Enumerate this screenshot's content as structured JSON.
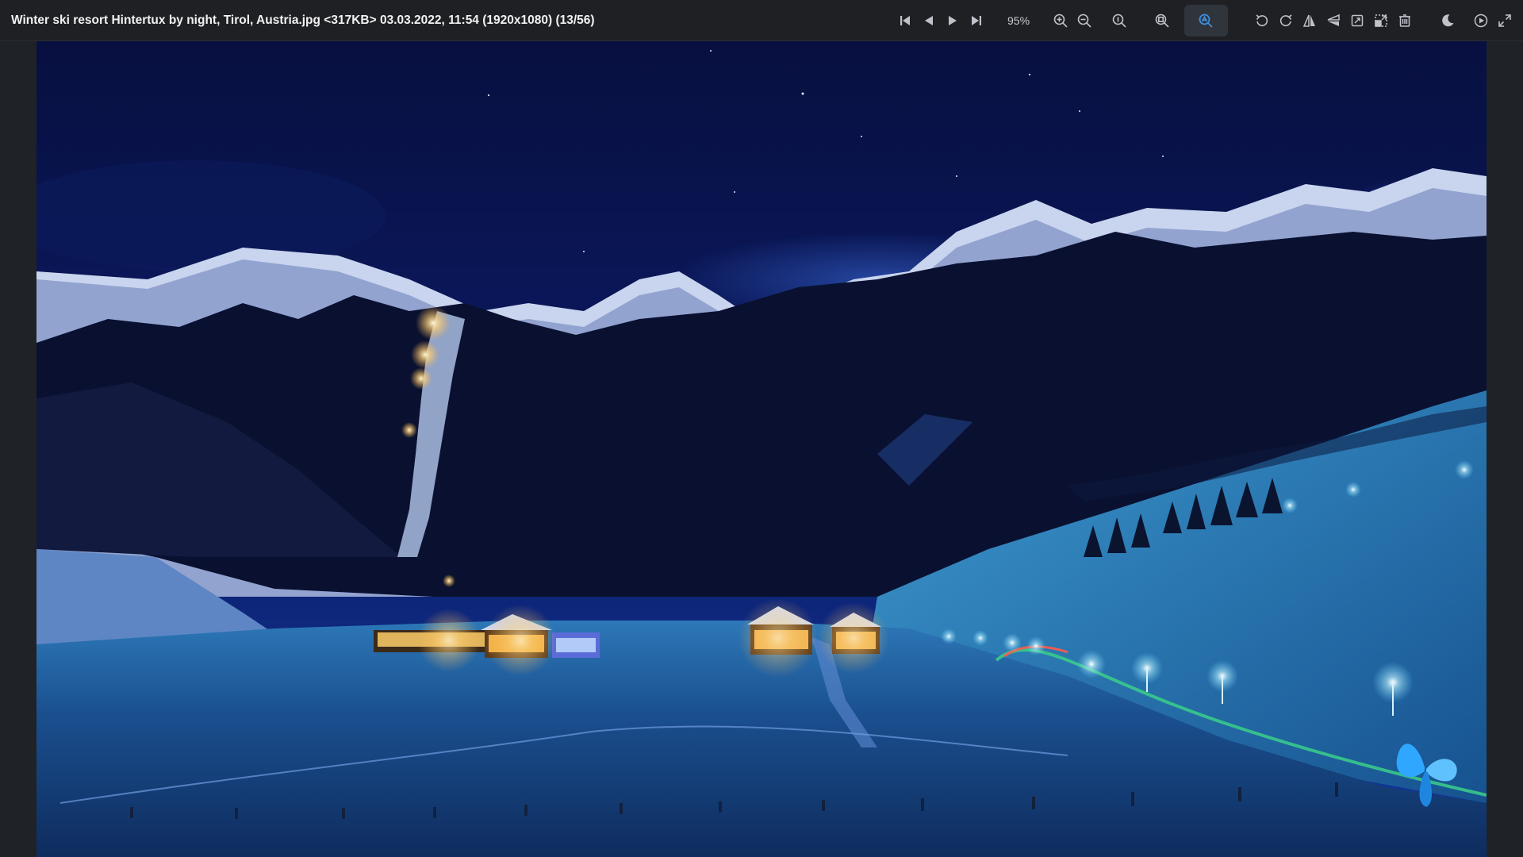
{
  "window": {
    "title": "Winter ski resort Hintertux by night, Tirol, Austria.jpg <317KB> 03.03.2022, 11:54 (1920x1080) (13/56)"
  },
  "toolbar": {
    "zoom_level": "95%",
    "nav_icons": [
      "first-image-icon",
      "previous-image-icon",
      "next-image-icon",
      "last-image-icon"
    ],
    "zoom_icons": [
      "zoom-in-icon",
      "zoom-out-icon",
      "zoom-actual-size-icon",
      "zoom-fit-icon",
      "zoom-auto-icon"
    ],
    "edit_icons": [
      "rotate-left-icon",
      "rotate-right-icon",
      "flip-horizontal-icon",
      "flip-vertical-icon",
      "crop-icon",
      "resize-icon",
      "delete-icon"
    ],
    "view_icons": [
      "dark-mode-icon",
      "slideshow-icon",
      "fullscreen-icon"
    ],
    "active_color": "#3d8fe0",
    "icon_color": "#bfc3c9"
  },
  "image": {
    "alt": "Winter ski resort Hintertux by night, Tirol, Austria",
    "sky_color": "#0b1554",
    "snow_color": "#1f5c9c",
    "light_color": "#ffd27a"
  }
}
